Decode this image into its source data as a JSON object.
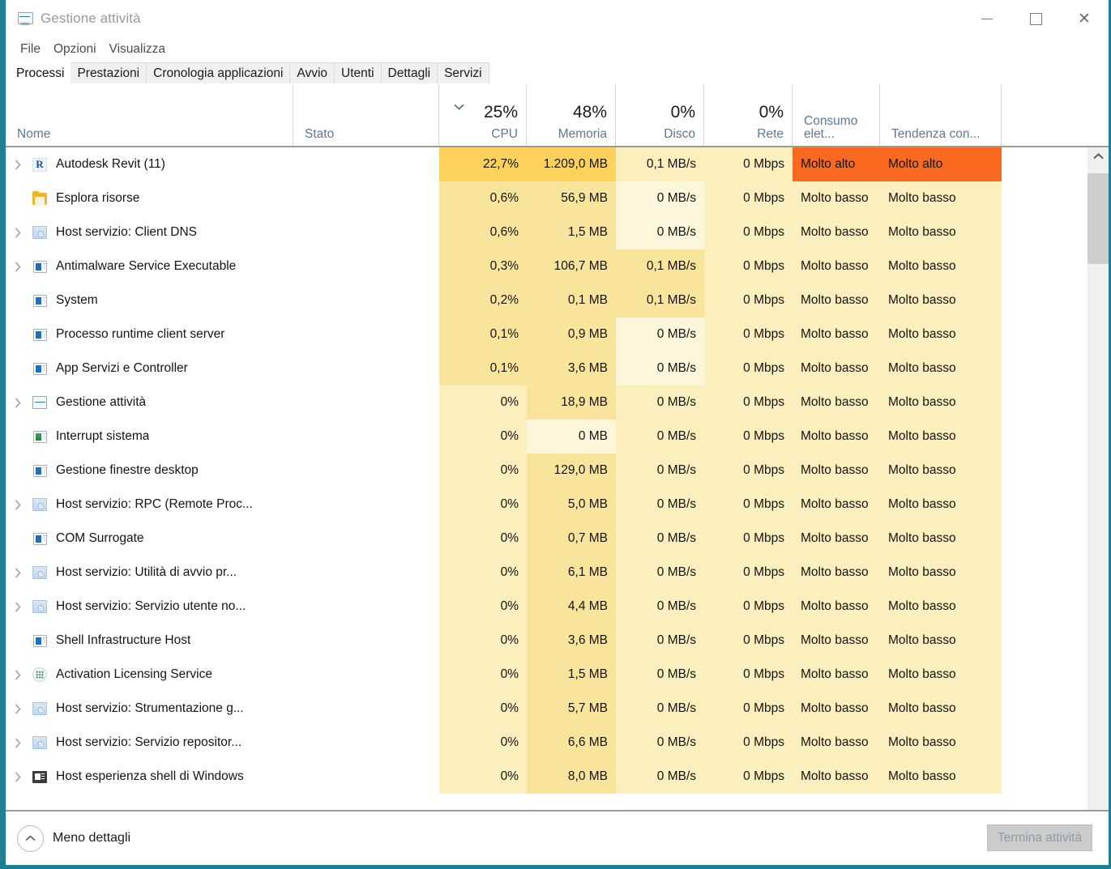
{
  "window": {
    "title": "Gestione attività",
    "icon": "task-manager-icon",
    "minimize": "–",
    "maximize": "□",
    "close": "✕"
  },
  "menu": {
    "items": [
      "File",
      "Opzioni",
      "Visualizza"
    ]
  },
  "tabs": {
    "active": "Processi",
    "items": [
      "Processi",
      "Prestazioni",
      "Cronologia applicazioni",
      "Avvio",
      "Utenti",
      "Dettagli",
      "Servizi"
    ]
  },
  "columns": [
    {
      "key": "name",
      "label": "Nome",
      "summary": "",
      "align": "left"
    },
    {
      "key": "stato",
      "label": "Stato",
      "summary": "",
      "align": "left"
    },
    {
      "key": "cpu",
      "label": "CPU",
      "summary": "25%",
      "align": "right",
      "sorted": "desc"
    },
    {
      "key": "mem",
      "label": "Memoria",
      "summary": "48%",
      "align": "right"
    },
    {
      "key": "disk",
      "label": "Disco",
      "summary": "0%",
      "align": "right"
    },
    {
      "key": "net",
      "label": "Rete",
      "summary": "0%",
      "align": "right"
    },
    {
      "key": "pw",
      "label": "Consumo elet...",
      "summary": "",
      "align": "left"
    },
    {
      "key": "pwt",
      "label": "Tendenza con...",
      "summary": "",
      "align": "left"
    }
  ],
  "colors": {
    "accent_teal": "#1d7f91",
    "heat_orange": "#f96a20",
    "heat_amber_strong": "#fcd25c",
    "heat_amber": "#f8e49b",
    "heat_cream": "#fbefbe",
    "heat_cream_light": "#fdf6da",
    "header_label": "#5b7894"
  },
  "rows": [
    {
      "expandable": true,
      "icon": "revit-icon",
      "name": "Autodesk Revit (11)",
      "stato": "",
      "cpu": "22,7%",
      "mem": "1.209,0 MB",
      "disk": "0,1 MB/s",
      "net": "0 Mbps",
      "pw": "Molto alto",
      "pwt": "Molto alto",
      "heat": {
        "cpu": "strong",
        "mem": "strong",
        "disk": "cream",
        "net": "cream",
        "pw": "orange",
        "pwt": "orange"
      }
    },
    {
      "expandable": false,
      "icon": "folder-icon",
      "name": "Esplora risorse",
      "stato": "",
      "cpu": "0,6%",
      "mem": "56,9 MB",
      "disk": "0 MB/s",
      "net": "0 Mbps",
      "pw": "Molto basso",
      "pwt": "Molto basso",
      "heat": {
        "cpu": "amber",
        "mem": "amber",
        "disk": "cream-light",
        "net": "cream",
        "pw": "cream",
        "pwt": "cream"
      }
    },
    {
      "expandable": true,
      "icon": "gear-icon",
      "name": "Host servizio: Client DNS",
      "stato": "",
      "cpu": "0,6%",
      "mem": "1,5 MB",
      "disk": "0 MB/s",
      "net": "0 Mbps",
      "pw": "Molto basso",
      "pwt": "Molto basso",
      "heat": {
        "cpu": "amber",
        "mem": "amber",
        "disk": "cream-light",
        "net": "cream",
        "pw": "cream",
        "pwt": "cream"
      }
    },
    {
      "expandable": true,
      "icon": "window-icon",
      "name": "Antimalware Service Executable",
      "stato": "",
      "cpu": "0,3%",
      "mem": "106,7 MB",
      "disk": "0,1 MB/s",
      "net": "0 Mbps",
      "pw": "Molto basso",
      "pwt": "Molto basso",
      "heat": {
        "cpu": "amber",
        "mem": "amber",
        "disk": "amber",
        "net": "cream",
        "pw": "cream",
        "pwt": "cream"
      }
    },
    {
      "expandable": false,
      "icon": "window-icon",
      "name": "System",
      "stato": "",
      "cpu": "0,2%",
      "mem": "0,1 MB",
      "disk": "0,1 MB/s",
      "net": "0 Mbps",
      "pw": "Molto basso",
      "pwt": "Molto basso",
      "heat": {
        "cpu": "amber",
        "mem": "amber",
        "disk": "amber",
        "net": "cream",
        "pw": "cream",
        "pwt": "cream"
      }
    },
    {
      "expandable": false,
      "icon": "window-icon",
      "name": "Processo runtime client server",
      "stato": "",
      "cpu": "0,1%",
      "mem": "0,9 MB",
      "disk": "0 MB/s",
      "net": "0 Mbps",
      "pw": "Molto basso",
      "pwt": "Molto basso",
      "heat": {
        "cpu": "amber",
        "mem": "amber",
        "disk": "cream-light",
        "net": "cream",
        "pw": "cream",
        "pwt": "cream"
      }
    },
    {
      "expandable": false,
      "icon": "window-icon",
      "name": "App Servizi e Controller",
      "stato": "",
      "cpu": "0,1%",
      "mem": "3,6 MB",
      "disk": "0 MB/s",
      "net": "0 Mbps",
      "pw": "Molto basso",
      "pwt": "Molto basso",
      "heat": {
        "cpu": "amber",
        "mem": "amber",
        "disk": "cream-light",
        "net": "cream",
        "pw": "cream",
        "pwt": "cream"
      }
    },
    {
      "expandable": true,
      "icon": "task-manager-icon",
      "name": "Gestione attività",
      "stato": "",
      "cpu": "0%",
      "mem": "18,9 MB",
      "disk": "0 MB/s",
      "net": "0 Mbps",
      "pw": "Molto basso",
      "pwt": "Molto basso",
      "heat": {
        "cpu": "cream",
        "mem": "amber",
        "disk": "cream",
        "net": "cream",
        "pw": "cream",
        "pwt": "cream"
      }
    },
    {
      "expandable": false,
      "icon": "window-green-icon",
      "name": "Interrupt sistema",
      "stato": "",
      "cpu": "0%",
      "mem": "0 MB",
      "disk": "0 MB/s",
      "net": "0 Mbps",
      "pw": "Molto basso",
      "pwt": "Molto basso",
      "heat": {
        "cpu": "cream",
        "mem": "cream-light",
        "disk": "cream",
        "net": "cream",
        "pw": "cream",
        "pwt": "cream"
      }
    },
    {
      "expandable": false,
      "icon": "window-icon",
      "name": "Gestione finestre desktop",
      "stato": "",
      "cpu": "0%",
      "mem": "129,0 MB",
      "disk": "0 MB/s",
      "net": "0 Mbps",
      "pw": "Molto basso",
      "pwt": "Molto basso",
      "heat": {
        "cpu": "cream",
        "mem": "amber",
        "disk": "cream",
        "net": "cream",
        "pw": "cream",
        "pwt": "cream"
      }
    },
    {
      "expandable": true,
      "icon": "gear-icon",
      "name": "Host servizio: RPC (Remote Proc...",
      "stato": "",
      "cpu": "0%",
      "mem": "5,0 MB",
      "disk": "0 MB/s",
      "net": "0 Mbps",
      "pw": "Molto basso",
      "pwt": "Molto basso",
      "heat": {
        "cpu": "cream",
        "mem": "amber",
        "disk": "cream",
        "net": "cream",
        "pw": "cream",
        "pwt": "cream"
      }
    },
    {
      "expandable": false,
      "icon": "window-icon",
      "name": "COM Surrogate",
      "stato": "",
      "cpu": "0%",
      "mem": "0,7 MB",
      "disk": "0 MB/s",
      "net": "0 Mbps",
      "pw": "Molto basso",
      "pwt": "Molto basso",
      "heat": {
        "cpu": "cream",
        "mem": "amber",
        "disk": "cream",
        "net": "cream",
        "pw": "cream",
        "pwt": "cream"
      }
    },
    {
      "expandable": true,
      "icon": "gear-icon",
      "name": "Host servizio: Utilità di avvio pr...",
      "stato": "",
      "cpu": "0%",
      "mem": "6,1 MB",
      "disk": "0 MB/s",
      "net": "0 Mbps",
      "pw": "Molto basso",
      "pwt": "Molto basso",
      "heat": {
        "cpu": "cream",
        "mem": "amber",
        "disk": "cream",
        "net": "cream",
        "pw": "cream",
        "pwt": "cream"
      }
    },
    {
      "expandable": true,
      "icon": "gear-icon",
      "name": "Host servizio: Servizio utente no...",
      "stato": "",
      "cpu": "0%",
      "mem": "4,4 MB",
      "disk": "0 MB/s",
      "net": "0 Mbps",
      "pw": "Molto basso",
      "pwt": "Molto basso",
      "heat": {
        "cpu": "cream",
        "mem": "amber",
        "disk": "cream",
        "net": "cream",
        "pw": "cream",
        "pwt": "cream"
      }
    },
    {
      "expandable": false,
      "icon": "window-icon",
      "name": "Shell Infrastructure Host",
      "stato": "",
      "cpu": "0%",
      "mem": "3,6 MB",
      "disk": "0 MB/s",
      "net": "0 Mbps",
      "pw": "Molto basso",
      "pwt": "Molto basso",
      "heat": {
        "cpu": "cream",
        "mem": "amber",
        "disk": "cream",
        "net": "cream",
        "pw": "cream",
        "pwt": "cream"
      }
    },
    {
      "expandable": true,
      "icon": "dots-circle-icon",
      "name": "Activation Licensing Service",
      "stato": "",
      "cpu": "0%",
      "mem": "1,5 MB",
      "disk": "0 MB/s",
      "net": "0 Mbps",
      "pw": "Molto basso",
      "pwt": "Molto basso",
      "heat": {
        "cpu": "cream",
        "mem": "amber",
        "disk": "cream",
        "net": "cream",
        "pw": "cream",
        "pwt": "cream"
      }
    },
    {
      "expandable": true,
      "icon": "gear-icon",
      "name": "Host servizio: Strumentazione g...",
      "stato": "",
      "cpu": "0%",
      "mem": "5,7 MB",
      "disk": "0 MB/s",
      "net": "0 Mbps",
      "pw": "Molto basso",
      "pwt": "Molto basso",
      "heat": {
        "cpu": "cream",
        "mem": "amber",
        "disk": "cream",
        "net": "cream",
        "pw": "cream",
        "pwt": "cream"
      }
    },
    {
      "expandable": true,
      "icon": "gear-icon",
      "name": "Host servizio: Servizio repositor...",
      "stato": "",
      "cpu": "0%",
      "mem": "6,6 MB",
      "disk": "0 MB/s",
      "net": "0 Mbps",
      "pw": "Molto basso",
      "pwt": "Molto basso",
      "heat": {
        "cpu": "cream",
        "mem": "amber",
        "disk": "cream",
        "net": "cream",
        "pw": "cream",
        "pwt": "cream"
      }
    },
    {
      "expandable": true,
      "icon": "dark-window-icon",
      "name": "Host esperienza shell di Windows",
      "stato": "",
      "cpu": "0%",
      "mem": "8,0 MB",
      "disk": "0 MB/s",
      "net": "0 Mbps",
      "pw": "Molto basso",
      "pwt": "Molto basso",
      "heat": {
        "cpu": "cream",
        "mem": "amber",
        "disk": "cream",
        "net": "cream",
        "pw": "cream",
        "pwt": "cream"
      }
    }
  ],
  "footer": {
    "less_details": "Meno dettagli",
    "less_details_icon": "chevron-up-icon",
    "end_task": "Termina attività",
    "end_task_enabled": false
  },
  "scrollbar": {
    "up_arrow": "▲",
    "position": "top"
  }
}
